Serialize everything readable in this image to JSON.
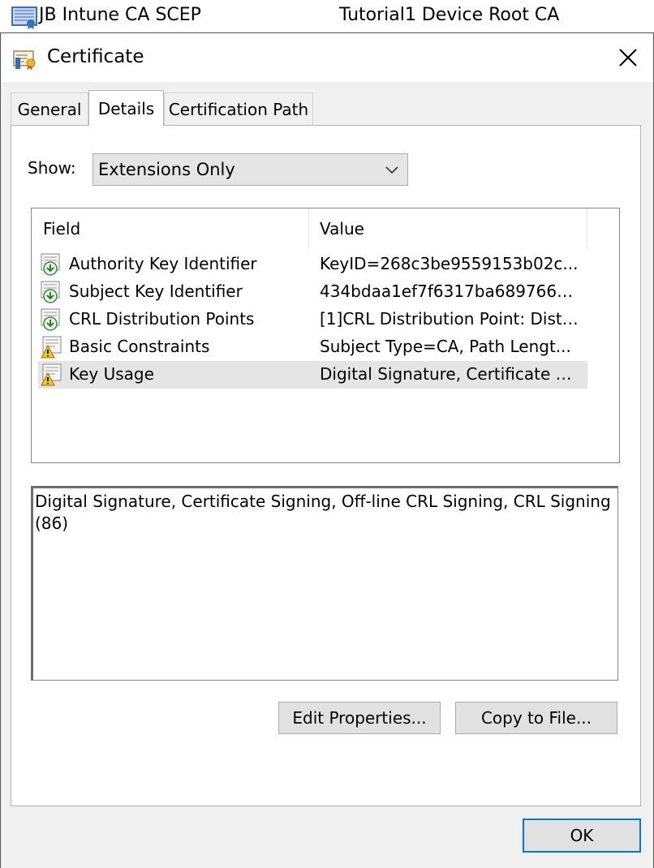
{
  "background_list": {
    "name": "JB Intune CA SCEP",
    "issuer": "Tutorial1 Device Root CA"
  },
  "dialog": {
    "title": "Certificate",
    "tabs": [
      {
        "label": "General"
      },
      {
        "label": "Details"
      },
      {
        "label": "Certification Path"
      }
    ],
    "active_tab": "Details",
    "show_label": "Show:",
    "show_value": "Extensions Only",
    "columns": {
      "field": "Field",
      "value": "Value"
    },
    "rows": [
      {
        "field": "Authority Key Identifier",
        "value": "KeyID=268c3be9559153b02c...",
        "icon": "extension-icon"
      },
      {
        "field": "Subject Key Identifier",
        "value": "434bdaa1ef7f6317ba689766e...",
        "icon": "extension-icon"
      },
      {
        "field": "CRL Distribution Points",
        "value": "[1]CRL Distribution Point: Distr...",
        "icon": "extension-icon"
      },
      {
        "field": "Basic Constraints",
        "value": "Subject Type=CA, Path Lengt...",
        "icon": "critical-extension-icon"
      },
      {
        "field": "Key Usage",
        "value": "Digital Signature, Certificate Si...",
        "icon": "critical-extension-icon"
      }
    ],
    "selected_row": "Key Usage",
    "detail_line1": "Digital Signature, Certificate Signing, Off-line CRL Signing, CRL Signing",
    "detail_line2": "(86)",
    "edit_properties_label": "Edit Properties...",
    "copy_to_file_label": "Copy to File...",
    "ok_label": "OK"
  }
}
